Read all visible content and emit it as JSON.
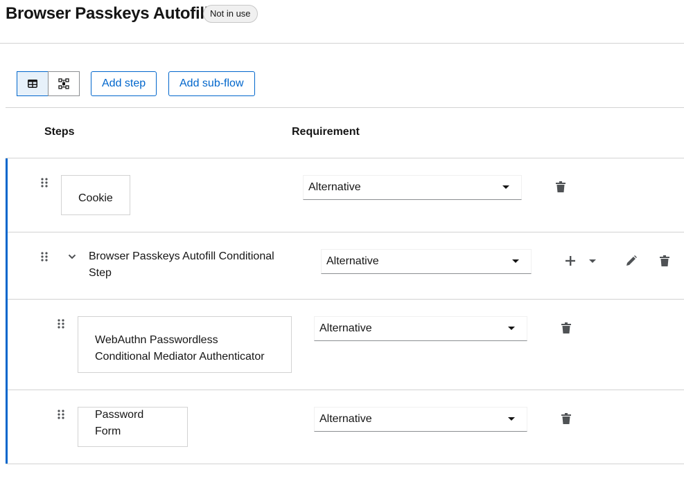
{
  "header": {
    "title": "Browser Passkeys Autofill",
    "status_badge": "Not in use"
  },
  "toolbar": {
    "view_toggle": {
      "table_view": {
        "icon": "table-icon",
        "selected": true
      },
      "diagram_view": {
        "icon": "diagram-icon",
        "selected": false
      }
    },
    "add_step_label": "Add step",
    "add_subflow_label": "Add sub-flow"
  },
  "table": {
    "columns": [
      "Steps",
      "Requirement"
    ],
    "rows": [
      {
        "name": "Cookie",
        "requirement": "Alternative",
        "level": 0,
        "type": "execution"
      },
      {
        "name": "Browser Passkeys Autofill Conditional Step",
        "requirement": "Alternative",
        "level": 0,
        "type": "sub-flow",
        "expanded": true
      },
      {
        "name": "WebAuthn Passwordless Conditional Mediator Authenticator",
        "requirement": "Alternative",
        "level": 1,
        "type": "execution"
      },
      {
        "name": "Password Form",
        "requirement": "Alternative",
        "level": 1,
        "type": "execution"
      }
    ]
  },
  "colors": {
    "accent": "#0066cc",
    "border": "#d2d2d2",
    "icon": "#4f5255"
  }
}
